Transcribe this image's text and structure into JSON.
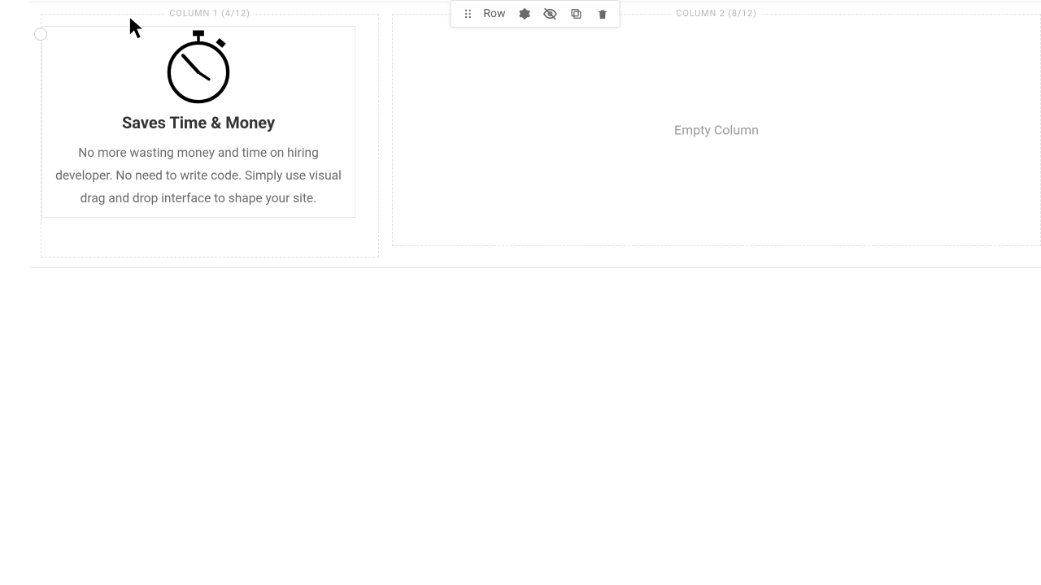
{
  "row": {
    "bg_label": "ROW",
    "toolbar_label": "Row"
  },
  "columns": {
    "col1_label": "COLUMN 1 (4/12)",
    "col2_label": "COLUMN 2 (8/12)",
    "empty_text": "Empty Column"
  },
  "card": {
    "heading": "Saves Time & Money",
    "description": "No more wasting money and time on hiring developer. No need to write code. Simply use visual drag and drop interface to shape your site."
  },
  "icons": {
    "stopwatch": "stopwatch-icon",
    "drag": "drag-handle-icon",
    "settings": "gear-icon",
    "visibility": "eye-off-icon",
    "copy": "copy-icon",
    "trash": "trash-icon"
  }
}
